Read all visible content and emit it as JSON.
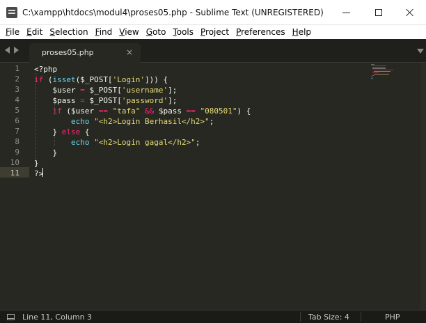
{
  "window": {
    "title": "C:\\xampp\\htdocs\\modul4\\proses05.php - Sublime Text (UNREGISTERED)"
  },
  "menu": {
    "items": [
      "File",
      "Edit",
      "Selection",
      "Find",
      "View",
      "Goto",
      "Tools",
      "Project",
      "Preferences",
      "Help"
    ]
  },
  "tabs": [
    {
      "label": "proses05.php",
      "close": "×",
      "active": true
    }
  ],
  "editor": {
    "line_numbers": [
      "1",
      "2",
      "3",
      "4",
      "5",
      "6",
      "7",
      "8",
      "9",
      "10",
      "11"
    ],
    "active_line": 11,
    "lines": [
      [
        [
          "<?php",
          "plain"
        ]
      ],
      [
        [
          "if",
          "kw"
        ],
        [
          " (",
          "plain"
        ],
        [
          "isset",
          "fn"
        ],
        [
          "($_POST[",
          "plain"
        ],
        [
          "'Login'",
          "str"
        ],
        [
          "])) {",
          "plain"
        ]
      ],
      [
        [
          "    $user ",
          "plain"
        ],
        [
          "=",
          "kw"
        ],
        [
          " $_POST[",
          "plain"
        ],
        [
          "'username'",
          "str"
        ],
        [
          "];",
          "plain"
        ]
      ],
      [
        [
          "    $pass ",
          "plain"
        ],
        [
          "=",
          "kw"
        ],
        [
          " $_POST[",
          "plain"
        ],
        [
          "'password'",
          "str"
        ],
        [
          "];",
          "plain"
        ]
      ],
      [
        [
          "    ",
          "plain"
        ],
        [
          "if",
          "kw"
        ],
        [
          " ($user ",
          "plain"
        ],
        [
          "==",
          "kw"
        ],
        [
          " ",
          "plain"
        ],
        [
          "\"tafa\"",
          "str"
        ],
        [
          " ",
          "plain"
        ],
        [
          "&&",
          "kw"
        ],
        [
          " $pass ",
          "plain"
        ],
        [
          "==",
          "kw"
        ],
        [
          " ",
          "plain"
        ],
        [
          "\"080501\"",
          "str"
        ],
        [
          ") {",
          "plain"
        ]
      ],
      [
        [
          "        ",
          "plain"
        ],
        [
          "echo",
          "fn"
        ],
        [
          " ",
          "plain"
        ],
        [
          "\"<h2>Login Berhasil</h2>\"",
          "str"
        ],
        [
          ";",
          "plain"
        ]
      ],
      [
        [
          "    } ",
          "plain"
        ],
        [
          "else",
          "kw"
        ],
        [
          " {",
          "plain"
        ]
      ],
      [
        [
          "        ",
          "plain"
        ],
        [
          "echo",
          "fn"
        ],
        [
          " ",
          "plain"
        ],
        [
          "\"<h2>Login gagal</h2>\"",
          "str"
        ],
        [
          ";",
          "plain"
        ]
      ],
      [
        [
          "    }",
          "plain"
        ]
      ],
      [
        [
          "}",
          "plain"
        ]
      ],
      [
        [
          "?>",
          "plain"
        ]
      ]
    ]
  },
  "status": {
    "position": "Line 11, Column 3",
    "tab_size": "Tab Size: 4",
    "syntax": "PHP"
  },
  "colors": {
    "background": "#272822",
    "keyword": "#f92672",
    "function": "#66d9ef",
    "string": "#e6db74",
    "plain": "#f8f8f2",
    "gutter_text": "#8f908a"
  },
  "icons": {
    "app": "sublime-text-icon",
    "minimize": "minimize-icon",
    "maximize": "maximize-icon",
    "close": "close-icon",
    "nav_back": "arrow-left-icon",
    "nav_forward": "arrow-right-icon",
    "tab_close": "close-icon",
    "tabs_dropdown": "chevron-down-icon",
    "panel": "panel-toggle-icon"
  }
}
